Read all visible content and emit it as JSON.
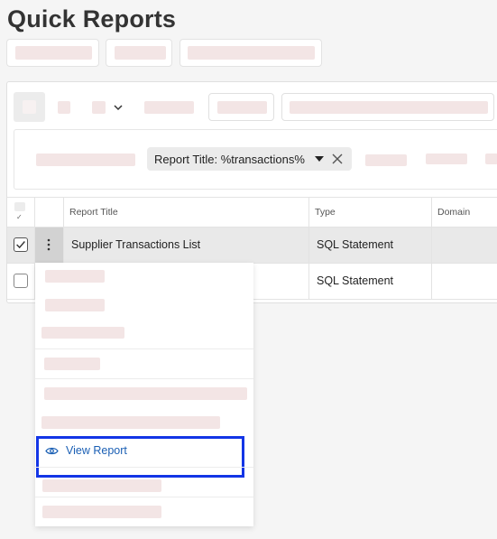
{
  "page": {
    "title": "Quick Reports"
  },
  "filter": {
    "chip_label": "Report Title: %transactions%"
  },
  "table": {
    "columns": [
      "Report Title",
      "Type",
      "Domain"
    ],
    "rows": [
      {
        "title": "Supplier Transactions List",
        "type": "SQL Statement",
        "domain": "",
        "checked": true
      },
      {
        "title": "",
        "type": "SQL Statement",
        "domain": "",
        "checked": false
      }
    ]
  },
  "context_menu": {
    "highlighted_item": {
      "label": "View Report",
      "icon": "eye-icon"
    }
  },
  "colors": {
    "highlight_border": "#1335e6",
    "link": "#1a5fb4",
    "placeholder": "#f3e5e5"
  }
}
